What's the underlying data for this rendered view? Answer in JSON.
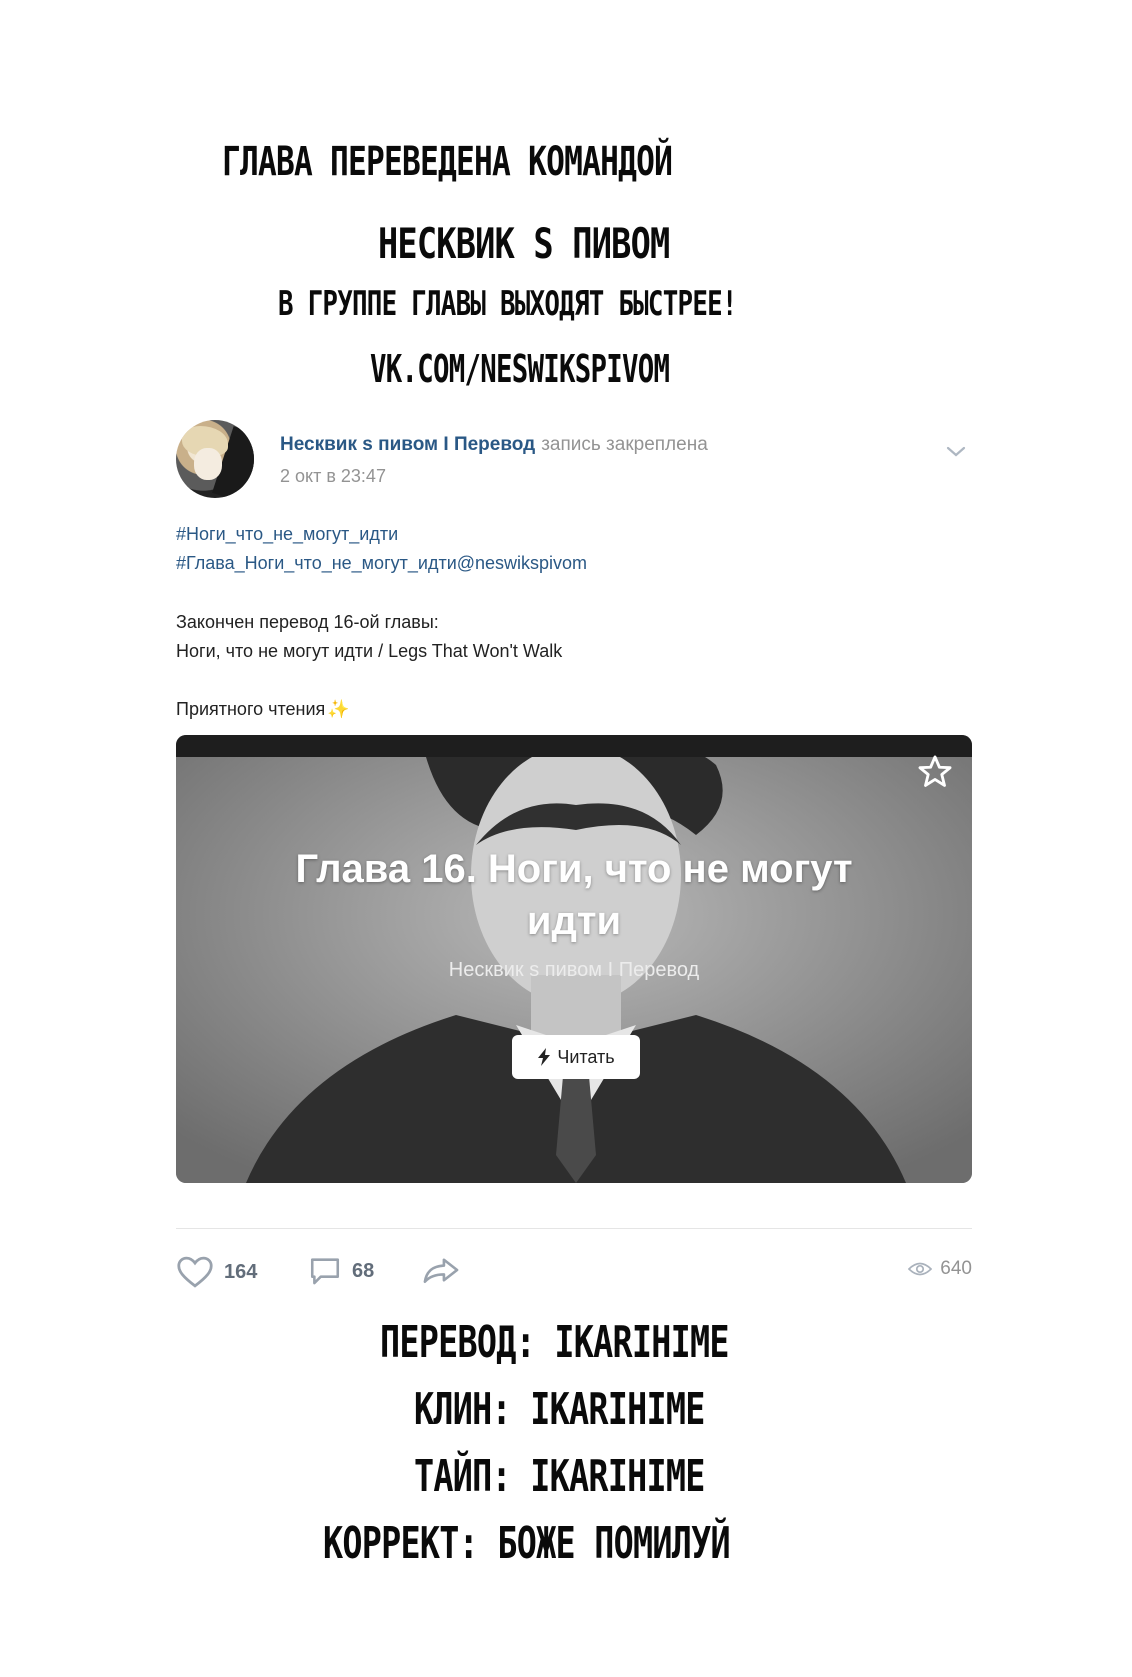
{
  "header": {
    "line1": "Глава переведена командой",
    "line2": "Несквик s пивом",
    "line3": "В группе главы выходят быстрее!",
    "line4": "vk.com/neswikspivom"
  },
  "post": {
    "author": "Несквик s пивом I Перевод",
    "pinned_label": "запись закреплена",
    "date": "2 окт в 23:47",
    "tag1": "#Ноги_что_не_могут_идти",
    "tag2": "#Глава_Ноги_что_не_могут_идти@neswikspivom",
    "text1": "Закончен перевод 16-ой главы:",
    "text2": "Ноги, что не могут идти / Legs That Won't Walk",
    "text3": "Приятного чтения",
    "sparkle": "✨",
    "article": {
      "title_line1": "Глава 16. Ноги, что не могут",
      "title_line2": "идти",
      "source": "Несквик s пивом I Перевод",
      "read_label": "Читать",
      "read_icon": "lightning-icon"
    },
    "actions": {
      "likes": "164",
      "comments": "68",
      "views": "640"
    }
  },
  "credits": {
    "translation": "Перевод: IKARIHIME",
    "clean": "Клин: IKARIHIME",
    "type": "Тайп: IKARIHIME",
    "proof": "Коррект: Боже помилуй"
  },
  "colors": {
    "link": "#2a5885",
    "muted": "#939393",
    "action": "#626d7a"
  }
}
